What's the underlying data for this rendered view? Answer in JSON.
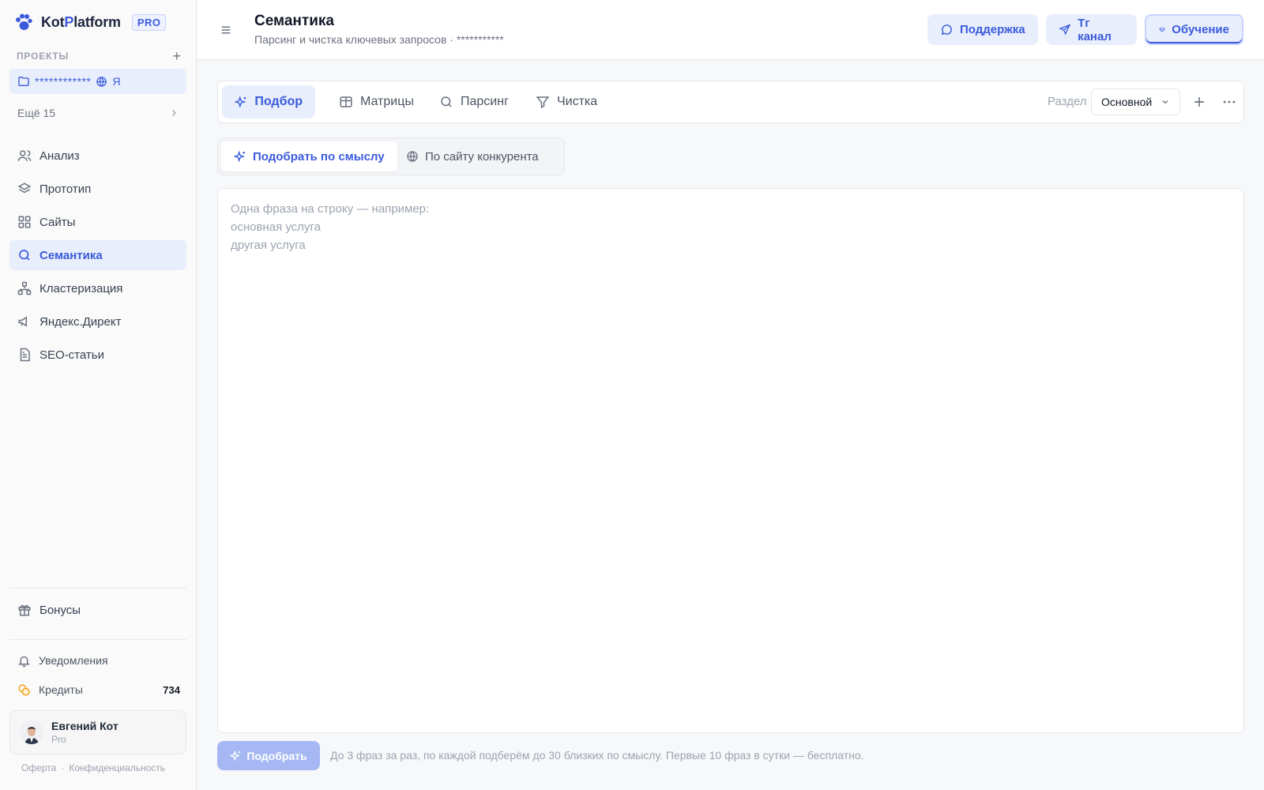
{
  "brand": {
    "name_part1": "Kot",
    "name_part2": "P",
    "name_part3": "latform",
    "badge": "PRO",
    "accent": "#3b5bdb"
  },
  "sidebar": {
    "projects_label": "ПРОЕКТЫ",
    "project": {
      "name": "************",
      "suffix": "Я"
    },
    "more_label": "Ещё 15",
    "items": [
      {
        "label": "Анализ",
        "icon": "users-icon",
        "active": false
      },
      {
        "label": "Прототип",
        "icon": "layers-icon",
        "active": false
      },
      {
        "label": "Сайты",
        "icon": "grid-icon",
        "active": false
      },
      {
        "label": "Семантика",
        "icon": "search-icon",
        "active": true
      },
      {
        "label": "Кластеризация",
        "icon": "cluster-icon",
        "active": false
      },
      {
        "label": "Яндекс.Директ",
        "icon": "megaphone-icon",
        "active": false
      },
      {
        "label": "SEO-статьи",
        "icon": "document-icon",
        "active": false
      }
    ],
    "bonus_label": "Бонусы",
    "notifications_label": "Уведомления",
    "credits_label": "Кредиты",
    "credits_value": "734",
    "user": {
      "name": "Евгений Кот",
      "plan": "Pro"
    },
    "footer": {
      "offer": "Оферта",
      "separator": "·",
      "privacy": "Конфиденциальность"
    }
  },
  "header": {
    "title": "Семантика",
    "subtitle": "Парсинг и чистка ключевых запросов · ***********",
    "buttons": {
      "support": "Поддержка",
      "tg": "Тг канал",
      "edu": "Обучение"
    }
  },
  "toolbar": {
    "tabs": [
      "Подбор",
      "Матрицы",
      "Парсинг",
      "Чистка"
    ],
    "section_label": "Раздел",
    "section_value": "Основной"
  },
  "mode": {
    "by_meaning": "Подобрать по смыслу",
    "by_competitor": "По сайту конкурента"
  },
  "input": {
    "placeholder": "Одна фраза на строку — например:\nосновная услуга\nдругая услуга",
    "value": ""
  },
  "actions": {
    "submit": "Подобрать",
    "hint": "До 3 фраз за раз, по каждой подберём до 30 близких по смыслу. Первые 10 фраз в сутки — бесплатно."
  }
}
